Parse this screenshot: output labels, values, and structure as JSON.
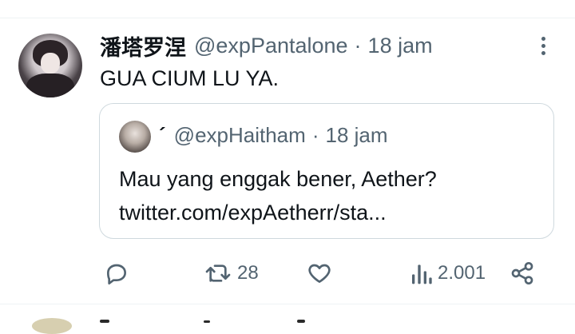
{
  "tweet": {
    "author": {
      "display_name": "潘塔罗涅",
      "handle": "@expPantalone",
      "avatar": "avatar-image"
    },
    "separator": "·",
    "time": "18 jam",
    "text": "GUA CIUM LU YA.",
    "more_icon": "more-vertical-icon"
  },
  "quote": {
    "author": {
      "display_name": "´",
      "handle": "@expHaitham",
      "avatar": "avatar-image"
    },
    "separator": "·",
    "time": "18 jam",
    "text_line1": "Mau yang enggak bener, Aether?",
    "text_line2": "twitter.com/expAetherr/sta..."
  },
  "actions": {
    "reply": {
      "icon": "reply-icon",
      "count": ""
    },
    "retweet": {
      "icon": "retweet-icon",
      "count": "28"
    },
    "like": {
      "icon": "heart-icon",
      "count": ""
    },
    "views": {
      "icon": "views-bar-chart-icon",
      "count": "2.001"
    },
    "share": {
      "icon": "share-icon"
    }
  },
  "colors": {
    "text_primary": "#0f1419",
    "text_secondary": "#536471",
    "border": "#cfd9de",
    "divider": "#eff3f4"
  }
}
